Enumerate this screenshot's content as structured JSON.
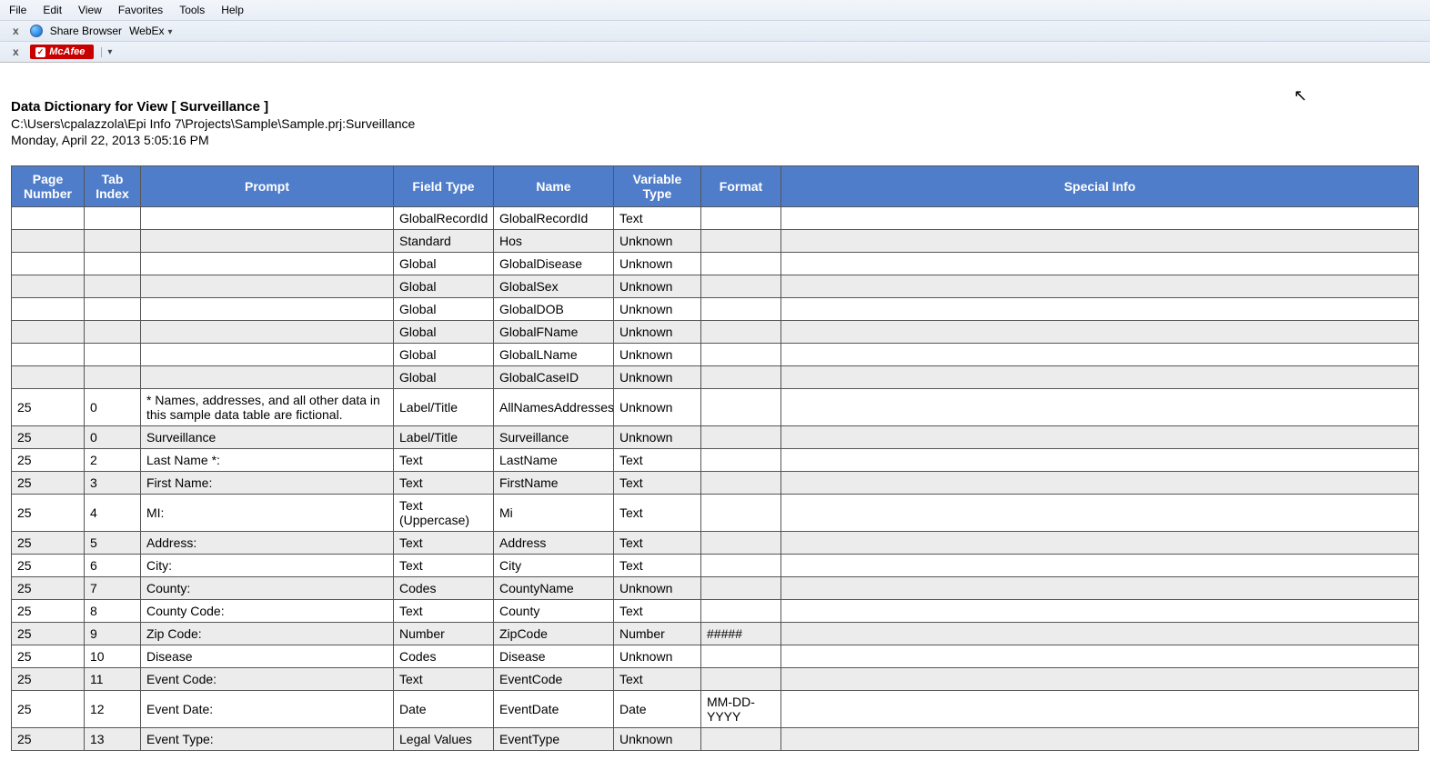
{
  "menu": {
    "items": [
      "File",
      "Edit",
      "View",
      "Favorites",
      "Tools",
      "Help"
    ]
  },
  "toolbar": {
    "share_browser": "Share Browser",
    "webex": "WebEx",
    "mcafee": "McAfee"
  },
  "report": {
    "title": "Data Dictionary for View [ Surveillance ]",
    "path": "C:\\Users\\cpalazzola\\Epi Info 7\\Projects\\Sample\\Sample.prj:Surveillance",
    "date": "Monday, April 22, 2013 5:05:16 PM"
  },
  "table": {
    "headers": [
      "Page Number",
      "Tab Index",
      "Prompt",
      "Field Type",
      "Name",
      "Variable Type",
      "Format",
      "Special Info"
    ],
    "rows": [
      [
        "",
        "",
        "",
        "GlobalRecordId",
        "GlobalRecordId",
        "Text",
        "",
        ""
      ],
      [
        "",
        "",
        "",
        "Standard",
        "Hos",
        "Unknown",
        "",
        ""
      ],
      [
        "",
        "",
        "",
        "Global",
        "GlobalDisease",
        "Unknown",
        "",
        ""
      ],
      [
        "",
        "",
        "",
        "Global",
        "GlobalSex",
        "Unknown",
        "",
        ""
      ],
      [
        "",
        "",
        "",
        "Global",
        "GlobalDOB",
        "Unknown",
        "",
        ""
      ],
      [
        "",
        "",
        "",
        "Global",
        "GlobalFName",
        "Unknown",
        "",
        ""
      ],
      [
        "",
        "",
        "",
        "Global",
        "GlobalLName",
        "Unknown",
        "",
        ""
      ],
      [
        "",
        "",
        "",
        "Global",
        "GlobalCaseID",
        "Unknown",
        "",
        ""
      ],
      [
        "25",
        "0",
        "* Names, addresses, and all other data in this sample data table are fictional.",
        "Label/Title",
        "AllNamesAddresses",
        "Unknown",
        "",
        ""
      ],
      [
        "25",
        "0",
        "Surveillance",
        "Label/Title",
        "Surveillance",
        "Unknown",
        "",
        ""
      ],
      [
        "25",
        "2",
        "Last Name *:",
        "Text",
        "LastName",
        "Text",
        "",
        ""
      ],
      [
        "25",
        "3",
        "First Name:",
        "Text",
        "FirstName",
        "Text",
        "",
        ""
      ],
      [
        "25",
        "4",
        "MI:",
        "Text (Uppercase)",
        "Mi",
        "Text",
        "",
        ""
      ],
      [
        "25",
        "5",
        "Address:",
        "Text",
        "Address",
        "Text",
        "",
        ""
      ],
      [
        "25",
        "6",
        "City:",
        "Text",
        "City",
        "Text",
        "",
        ""
      ],
      [
        "25",
        "7",
        "County:",
        "Codes",
        "CountyName",
        "Unknown",
        "",
        ""
      ],
      [
        "25",
        "8",
        "County Code:",
        "Text",
        "County",
        "Text",
        "",
        ""
      ],
      [
        "25",
        "9",
        "Zip Code:",
        "Number",
        "ZipCode",
        "Number",
        "#####",
        ""
      ],
      [
        "25",
        "10",
        "Disease",
        "Codes",
        "Disease",
        "Unknown",
        "",
        ""
      ],
      [
        "25",
        "11",
        "Event Code:",
        "Text",
        "EventCode",
        "Text",
        "",
        ""
      ],
      [
        "25",
        "12",
        "Event Date:",
        "Date",
        "EventDate",
        "Date",
        "MM-DD-YYYY",
        ""
      ],
      [
        "25",
        "13",
        "Event Type:",
        "Legal Values",
        "EventType",
        "Unknown",
        "",
        ""
      ]
    ]
  }
}
